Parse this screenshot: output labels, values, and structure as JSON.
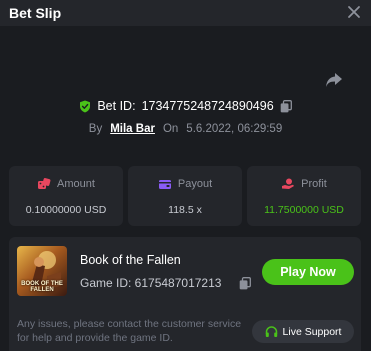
{
  "header": {
    "title": "Bet Slip"
  },
  "bet": {
    "id_label": "Bet ID:",
    "id_value": "1734775248724890496",
    "by_label": "By",
    "user": "Mila Bar",
    "on_label": "On",
    "datetime": "5.6.2022, 06:29:59"
  },
  "stats": [
    {
      "label": "Amount",
      "value": "0.10000000 USD",
      "icon": "dice-icon",
      "color": "#c8cbd2"
    },
    {
      "label": "Payout",
      "value": "118.5 x",
      "icon": "wallet-icon",
      "color": "#c8cbd2"
    },
    {
      "label": "Profit",
      "value": "11.7500000 USD",
      "icon": "hand-coins-icon",
      "color": "#4ac219"
    }
  ],
  "game": {
    "thumb_title": "BOOK OF THE FALLEN",
    "name": "Book of the Fallen",
    "id_text": "Game ID: 6175487017213",
    "play_label": "Play Now"
  },
  "support": {
    "text": "Any issues, please contact the customer service for help and provide the game ID.",
    "button_label": "Live Support"
  },
  "colors": {
    "accent_green": "#4ac219",
    "amount_icon": "#e8475f",
    "payout_icon": "#8a5cf5",
    "profit_icon": "#e8475f"
  }
}
